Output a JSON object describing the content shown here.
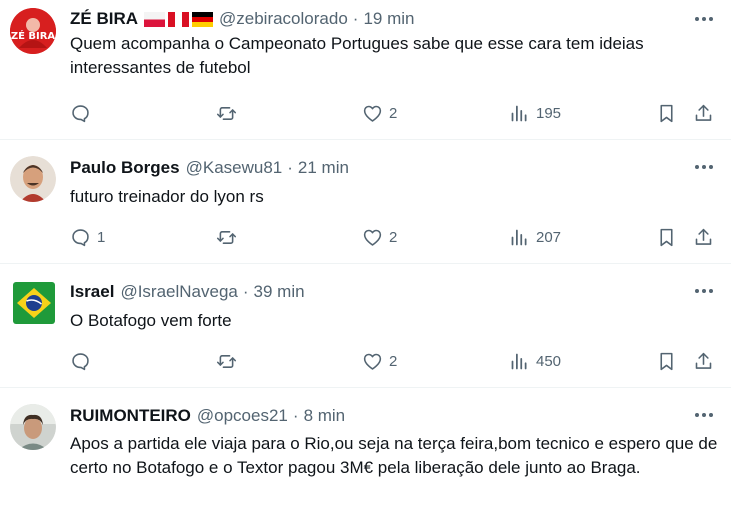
{
  "tweets": [
    {
      "name": "ZÉ BIRA",
      "flags": [
        "poland",
        "peru",
        "germany"
      ],
      "avatar": "avatar-zebira",
      "handle": "@zebiracolorado",
      "time": "19 min",
      "text": "Quem acompanha o Campeonato Portugues sabe que esse cara tem ideias interessantes de futebol",
      "replies": "",
      "retweets": "",
      "likes": "2",
      "views": "195"
    },
    {
      "name": "Paulo Borges",
      "flags": [],
      "avatar": "avatar-paulo",
      "handle": "@Kasewu81",
      "time": "21 min",
      "text": "futuro treinador do lyon rs",
      "replies": "1",
      "retweets": "",
      "likes": "2",
      "views": "207"
    },
    {
      "name": "Israel",
      "flags": [],
      "avatar": "avatar-brazil-flag",
      "handle": "@IsraelNavega",
      "time": "39 min",
      "text": "O Botafogo vem forte",
      "replies": "",
      "retweets": "",
      "likes": "2",
      "views": "450"
    },
    {
      "name": "RUIMONTEIRO",
      "flags": [],
      "avatar": "avatar-rui",
      "handle": "@opcoes21",
      "time": "8 min",
      "text": "Apos a partida ele viaja para o Rio,ou seja na terça feira,bom tecnico e espero que de certo no Botafogo e o Textor pagou 3M€ pela liberação dele junto ao Braga.",
      "separator": "·"
    }
  ],
  "separator": "·",
  "avatar_text": "ZÉ BIRA",
  "colors": {
    "secondary": "#536471",
    "text": "#0f1419",
    "divider": "#eff3f4"
  }
}
